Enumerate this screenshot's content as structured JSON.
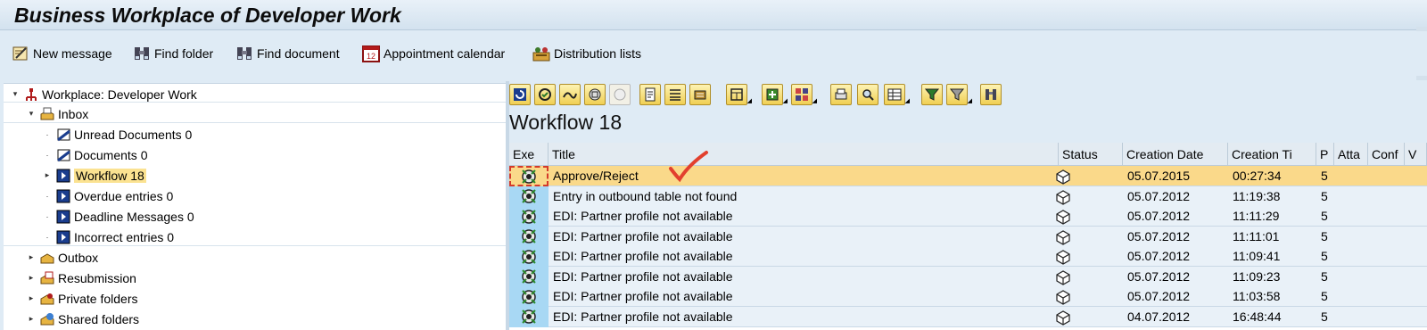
{
  "window": {
    "title": "Business Workplace of Developer Work"
  },
  "app_toolbar": [
    {
      "label": "New message",
      "icon": "new-message-icon"
    },
    {
      "label": "Find folder",
      "icon": "binoculars-icon"
    },
    {
      "label": "Find document",
      "icon": "binoculars-icon"
    },
    {
      "label": "Appointment calendar",
      "icon": "calendar-icon"
    },
    {
      "label": "Distribution lists",
      "icon": "distribution-list-icon"
    }
  ],
  "tree": {
    "root": "Workplace: Developer Work",
    "inbox": "Inbox",
    "inbox_items": [
      "Unread Documents 0",
      "Documents 0",
      "Workflow 18",
      "Overdue entries 0",
      "Deadline Messages 0",
      "Incorrect entries 0"
    ],
    "folders": [
      "Outbox",
      "Resubmission",
      "Private folders",
      "Shared folders"
    ],
    "selected": "Workflow 18"
  },
  "list": {
    "title": "Workflow 18",
    "columns": [
      "Exe",
      "Title",
      "Status",
      "Creation Date",
      "Creation Ti",
      "P",
      "Atta",
      "Conf",
      "V"
    ],
    "rows": [
      {
        "title": "Approve/Reject",
        "date": "05.07.2015",
        "time": "00:27:34",
        "priority": "5"
      },
      {
        "title": "Entry in outbound table not found",
        "date": "05.07.2012",
        "time": "11:19:38",
        "priority": "5"
      },
      {
        "title": "EDI: Partner profile not available",
        "date": "05.07.2012",
        "time": "11:11:29",
        "priority": "5"
      },
      {
        "title": "EDI: Partner profile not available",
        "date": "05.07.2012",
        "time": "11:11:01",
        "priority": "5"
      },
      {
        "title": "EDI: Partner profile not available",
        "date": "05.07.2012",
        "time": "11:09:41",
        "priority": "5"
      },
      {
        "title": "EDI: Partner profile not available",
        "date": "05.07.2012",
        "time": "11:09:23",
        "priority": "5"
      },
      {
        "title": "EDI: Partner profile not available",
        "date": "05.07.2012",
        "time": "11:03:58",
        "priority": "5"
      },
      {
        "title": "EDI: Partner profile not available",
        "date": "04.07.2012",
        "time": "16:48:44",
        "priority": "5"
      }
    ],
    "highlighted_row": "Approve/Reject"
  },
  "list_toolbar_icons": [
    "refresh-icon",
    "execute-icon",
    "forward-icon",
    "object-icon",
    "object-disabled-icon",
    "detail-icon",
    "sort-icon",
    "print-preview-icon",
    "layout-icon",
    "add-icon",
    "grid-icon",
    "print-icon",
    "find-icon",
    "filter-columns-icon",
    "filter-icon",
    "filter-dropdown-icon",
    "binoculars-icon"
  ],
  "colors": {
    "highlight": "#fad98a",
    "accent_red": "#d43a2a",
    "selection": "#fbe291"
  }
}
